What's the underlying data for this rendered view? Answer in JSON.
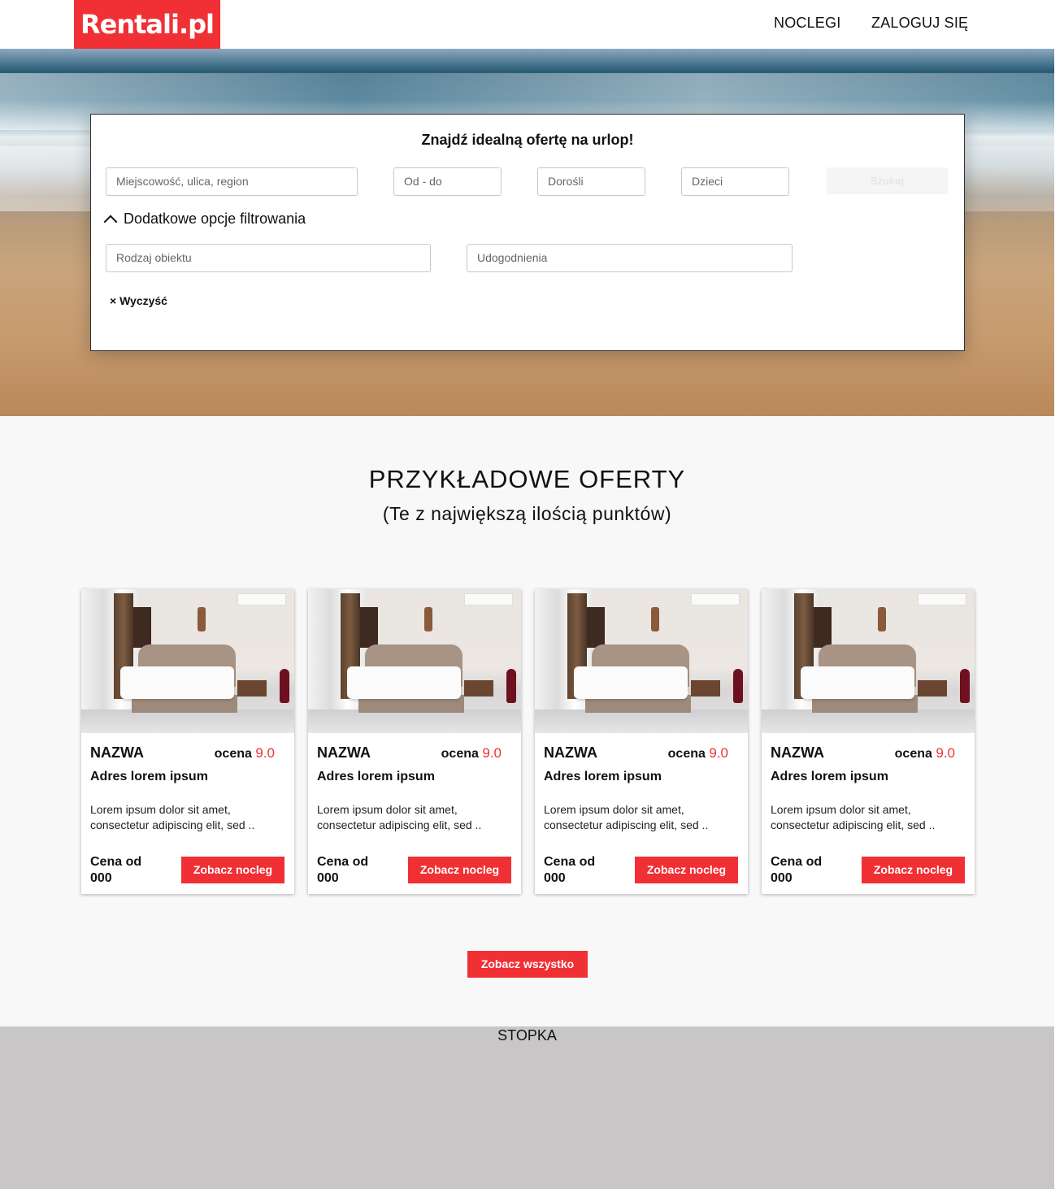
{
  "header": {
    "logo": "Rentali.pl",
    "nav": [
      "NOCLEGI",
      "ZALOGUJ SIĘ"
    ]
  },
  "search": {
    "title": "Znajdź idealną ofertę na urlop!",
    "location_placeholder": "Miejscowość, ulica, region",
    "dates_placeholder": "Od - do",
    "adults_placeholder": "Dorośli",
    "children_placeholder": "Dzieci",
    "search_label": "Szukaj",
    "more_filters": "Dodatkowe opcje filtrowania",
    "type_placeholder": "Rodzaj obiektu",
    "amenities_placeholder": "Udogodnienia",
    "clear_label": "× Wyczyść"
  },
  "section": {
    "title": "PRZYKŁADOWE OFERTY",
    "subtitle": "(Te z największą ilością punktów)"
  },
  "cards": [
    {
      "name": "NAZWA",
      "rating_label": "ocena",
      "rating": "9.0",
      "address": "Adres lorem ipsum",
      "desc": "Lorem ipsum dolor sit amet, consectetur adipiscing elit, sed ..",
      "price": "Cena od 000",
      "button": "Zobacz nocleg"
    },
    {
      "name": "NAZWA",
      "rating_label": "ocena",
      "rating": "9.0",
      "address": "Adres lorem ipsum",
      "desc": "Lorem ipsum dolor sit amet, consectetur adipiscing elit, sed ..",
      "price": "Cena od 000",
      "button": "Zobacz nocleg"
    },
    {
      "name": "NAZWA",
      "rating_label": "ocena",
      "rating": "9.0",
      "address": "Adres lorem ipsum",
      "desc": "Lorem ipsum dolor sit amet, consectetur adipiscing elit, sed ..",
      "price": "Cena od 000",
      "button": "Zobacz nocleg"
    },
    {
      "name": "NAZWA",
      "rating_label": "ocena",
      "rating": "9.0",
      "address": "Adres lorem ipsum",
      "desc": "Lorem ipsum dolor sit amet, consectetur adipiscing elit, sed ..",
      "price": "Cena od 000",
      "button": "Zobacz nocleg"
    }
  ],
  "see_all": "Zobacz wszystko",
  "footer": "STOPKA",
  "colors": {
    "accent": "#f03035",
    "footer": "#c8c6c7",
    "background": "#f8f8f8"
  }
}
